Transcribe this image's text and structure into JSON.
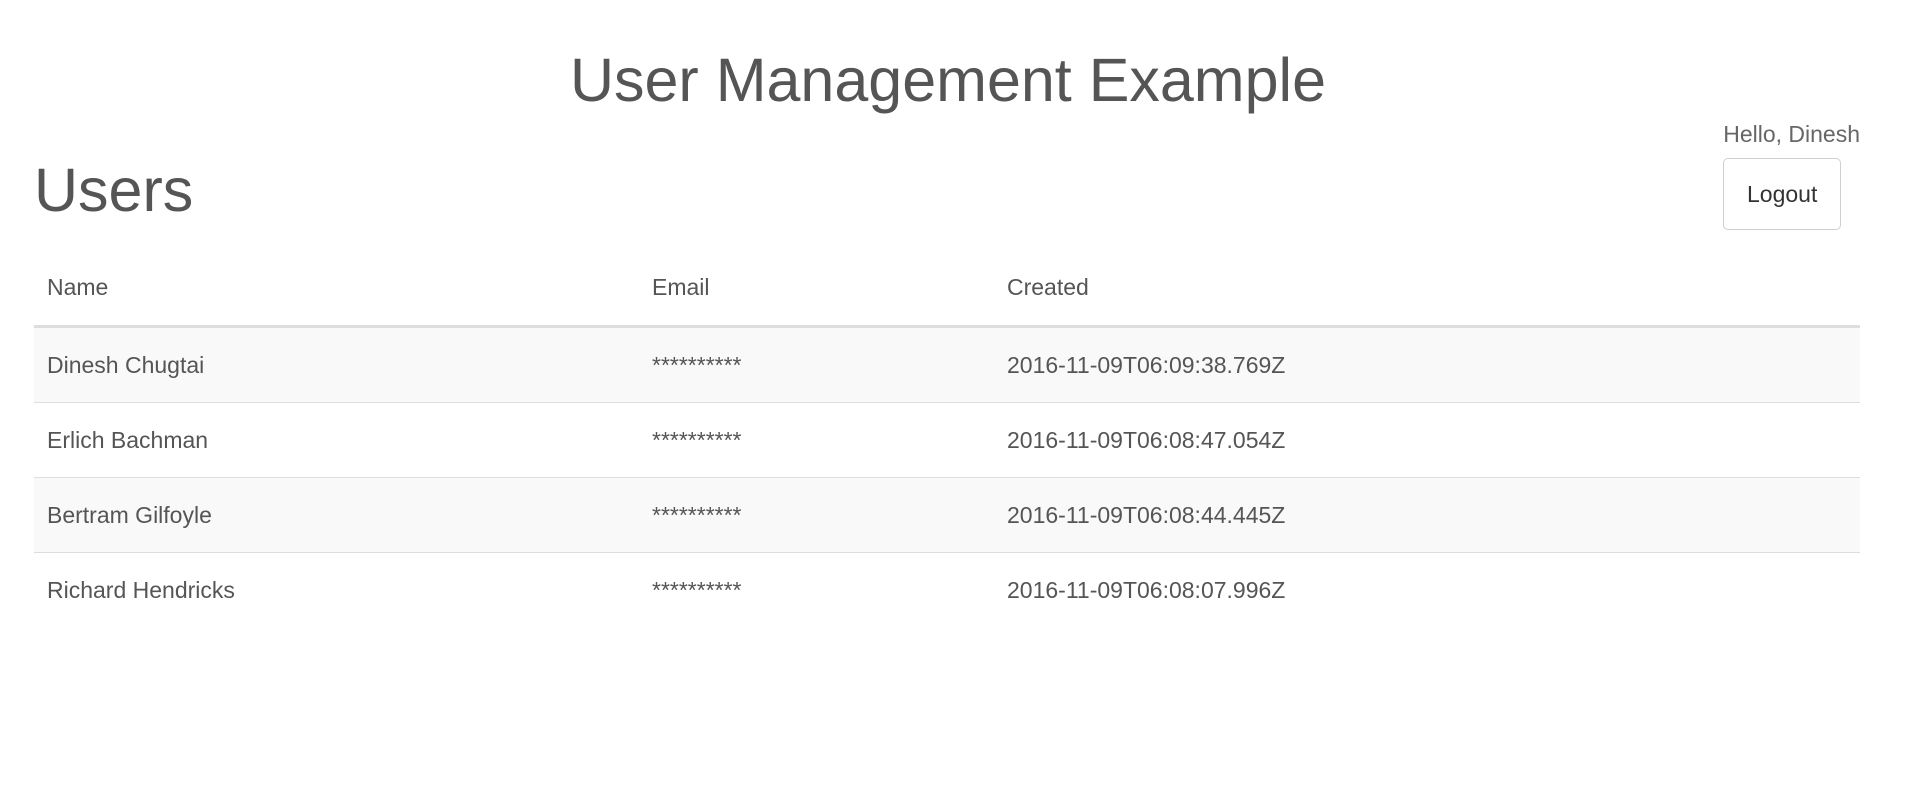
{
  "app": {
    "title": "User Management Example"
  },
  "page": {
    "title": "Users"
  },
  "user_box": {
    "greeting": "Hello, Dinesh",
    "logout_label": "Logout"
  },
  "table": {
    "columns": [
      "Name",
      "Email",
      "Created"
    ],
    "rows": [
      {
        "name": "Dinesh Chugtai",
        "email": "**********",
        "created": "2016-11-09T06:09:38.769Z"
      },
      {
        "name": "Erlich Bachman",
        "email": "**********",
        "created": "2016-11-09T06:08:47.054Z"
      },
      {
        "name": "Bertram Gilfoyle",
        "email": "**********",
        "created": "2016-11-09T06:08:44.445Z"
      },
      {
        "name": "Richard Hendricks",
        "email": "**********",
        "created": "2016-11-09T06:08:07.996Z"
      }
    ]
  },
  "colors": {
    "text": "#555555",
    "stripe": "#f9f9f9",
    "border": "#dddddd"
  }
}
